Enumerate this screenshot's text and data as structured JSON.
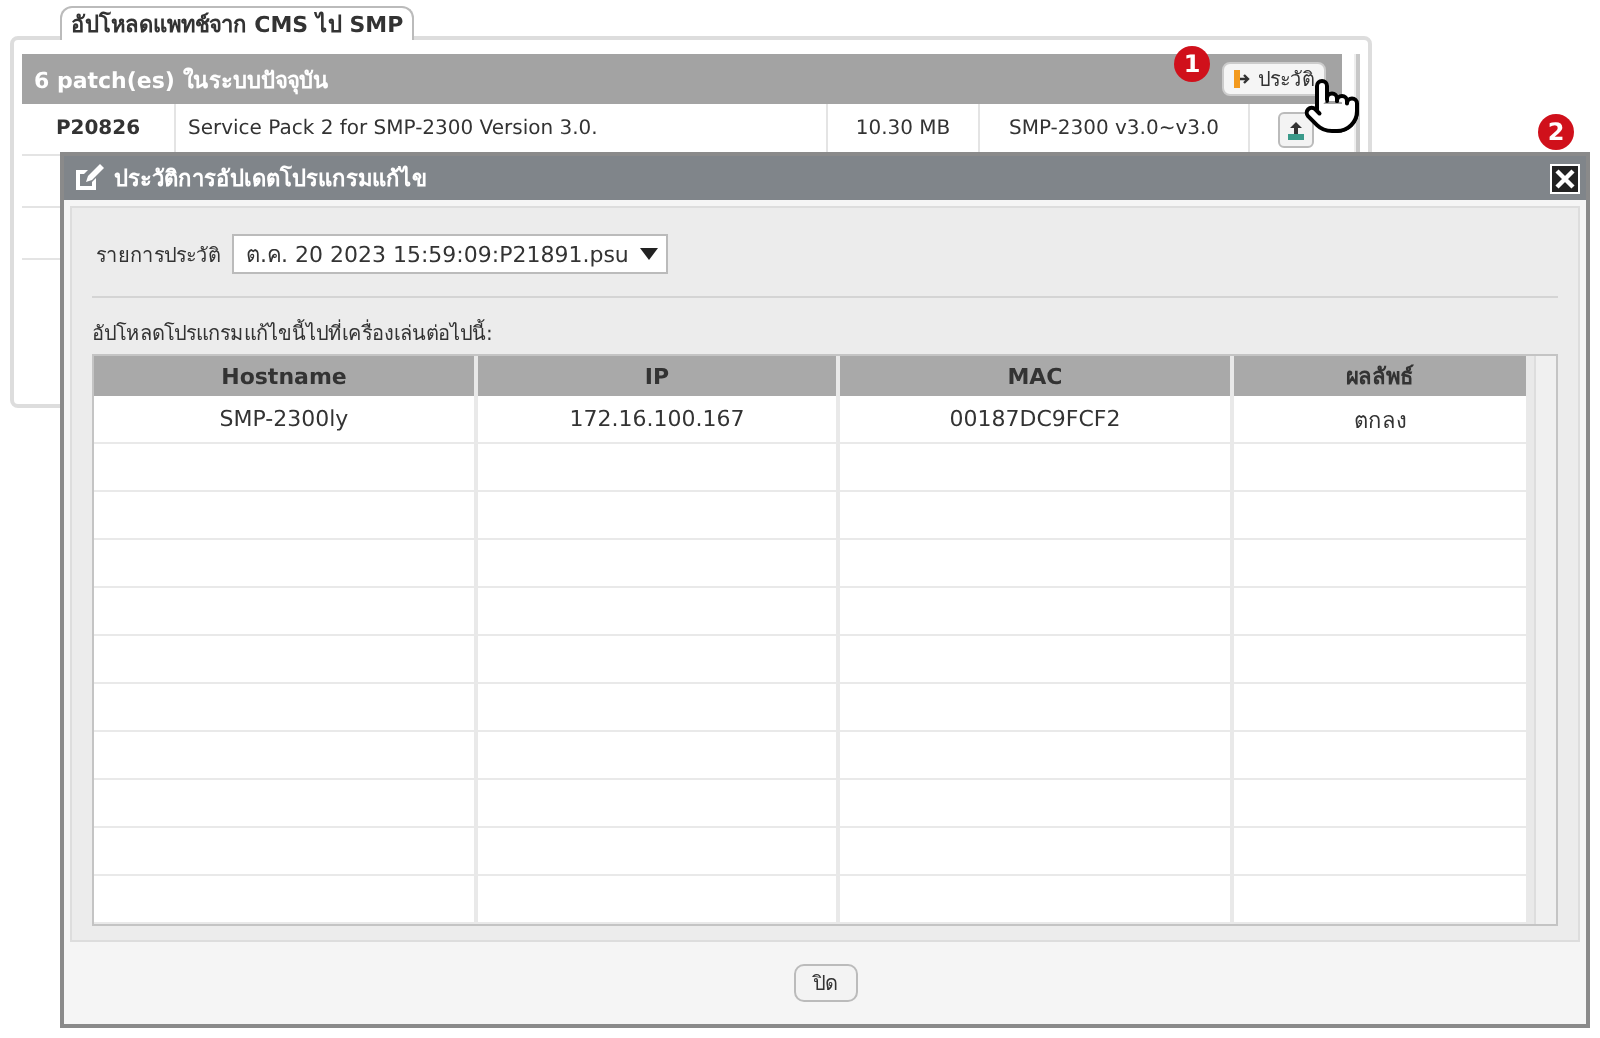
{
  "tab": {
    "label": "อัปโหลดแพทช์จาก CMS ไป SMP"
  },
  "patch_panel": {
    "header": "6 patch(es) ในระบบปัจจุบัน",
    "history_button": "ประวัติ",
    "rows": [
      {
        "id": "P20826",
        "description": "Service Pack 2 for SMP-2300 Version 3.0.",
        "size": "10.30 MB",
        "models": "SMP-2300 v3.0~v3.0"
      }
    ]
  },
  "callouts": [
    "1",
    "2"
  ],
  "dialog": {
    "title": "ประวัติการอัปเดตโปรแกรมแก้ไข",
    "history_label": "รายการประวัติ",
    "history_value": "ต.ค. 20 2023 15:59:09:P21891.psu",
    "table_caption": "อัปโหลดโปรแกรมแก้ไขนี้ไปที่เครื่องเล่นต่อไปนี้:",
    "columns": [
      "Hostname",
      "IP",
      "MAC",
      "ผลลัพธ์"
    ],
    "rows": [
      [
        "SMP-2300ly",
        "172.16.100.167",
        "00187DC9FCF2",
        "ตกลง"
      ]
    ],
    "close_button": "ปิด"
  }
}
